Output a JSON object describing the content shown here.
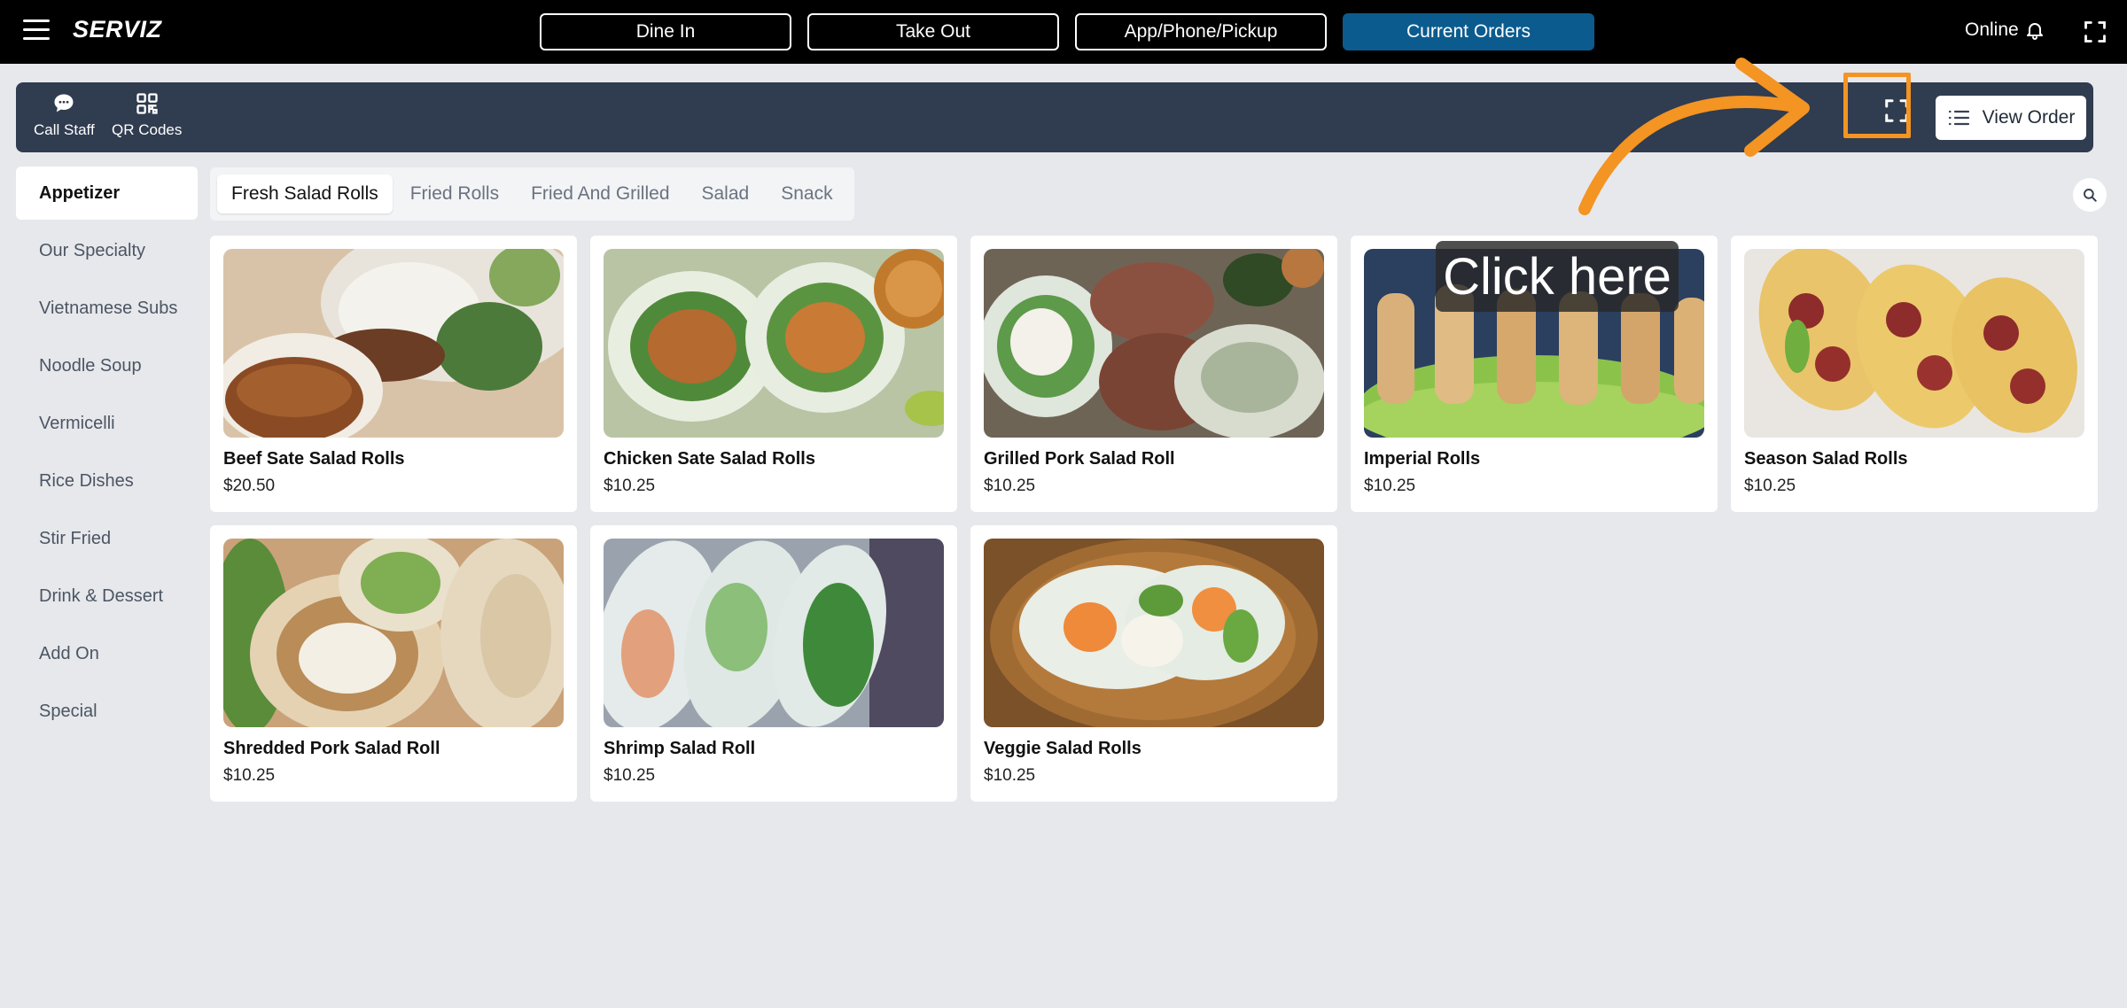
{
  "topbar": {
    "brand": "SERVIZ",
    "order_types": [
      {
        "label": "Dine In",
        "active": false
      },
      {
        "label": "Take Out",
        "active": false
      },
      {
        "label": "App/Phone/Pickup",
        "active": false
      },
      {
        "label": "Current Orders",
        "active": true
      }
    ],
    "status": "Online"
  },
  "actionbar": {
    "call_staff": "Call Staff",
    "qr_codes": "QR Codes",
    "view_order": "View Order"
  },
  "sidebar": {
    "items": [
      "Appetizer",
      "Our Specialty",
      "Vietnamese Subs",
      "Noodle Soup",
      "Vermicelli",
      "Rice Dishes",
      "Stir Fried",
      "Drink & Dessert",
      "Add On",
      "Special"
    ]
  },
  "subtabs": [
    "Fresh Salad Rolls",
    "Fried Rolls",
    "Fried And Grilled",
    "Salad",
    "Snack"
  ],
  "items": [
    {
      "name": "Beef Sate Salad Rolls",
      "price": "$20.50"
    },
    {
      "name": "Chicken Sate Salad Rolls",
      "price": "$10.25"
    },
    {
      "name": "Grilled Pork Salad Roll",
      "price": "$10.25"
    },
    {
      "name": "Imperial Rolls",
      "price": "$10.25"
    },
    {
      "name": "Season Salad Rolls",
      "price": "$10.25"
    },
    {
      "name": "Shredded Pork Salad Roll",
      "price": "$10.25"
    },
    {
      "name": "Shrimp Salad Roll",
      "price": "$10.25"
    },
    {
      "name": "Veggie Salad Rolls",
      "price": "$10.25"
    }
  ],
  "annotation": {
    "text": "Click here"
  },
  "colors": {
    "accent": "#0c5b8e",
    "highlight": "#f39423",
    "bar": "#303c4f"
  }
}
